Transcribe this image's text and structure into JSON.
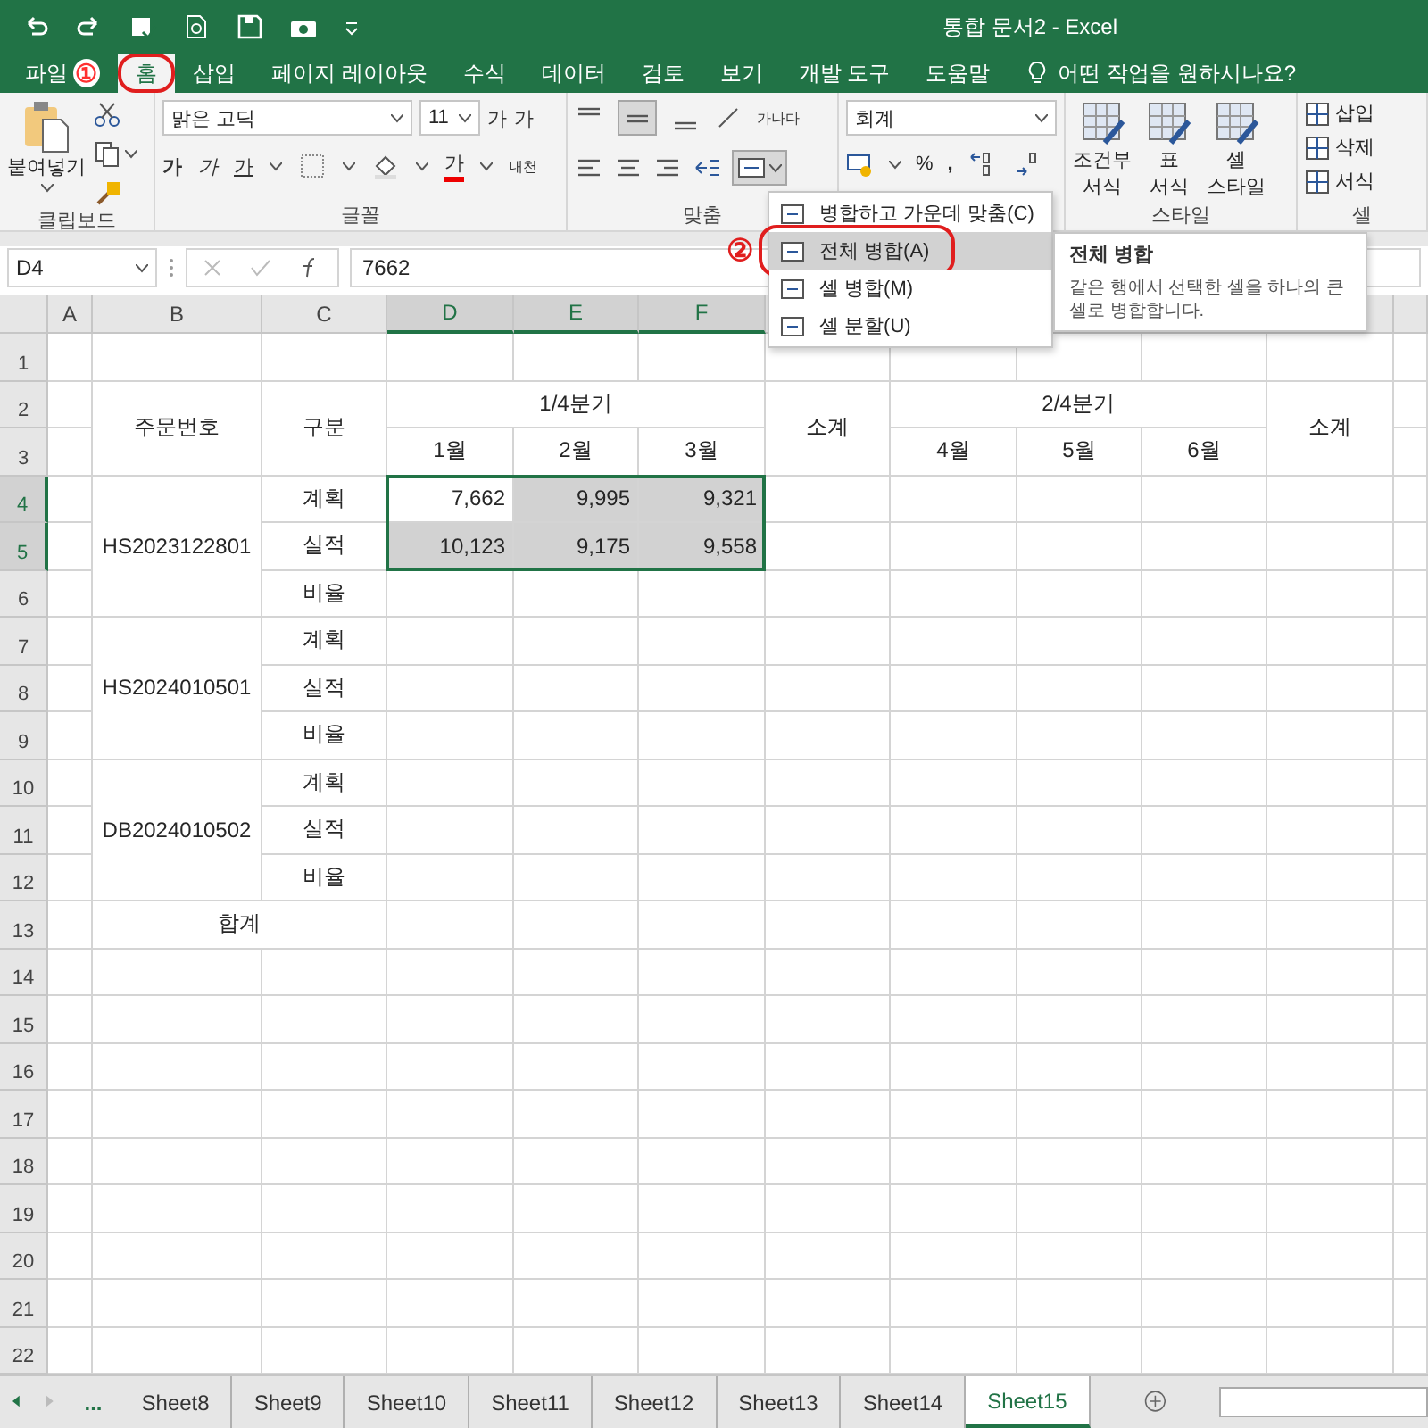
{
  "title_bar": {
    "title": "통합 문서2  -  Excel"
  },
  "ribbon_tabs": [
    {
      "label": "파일",
      "selected": false,
      "step": "①",
      "highlighted": false
    },
    {
      "label": "홈",
      "selected": true,
      "highlighted": true
    },
    {
      "label": "삽입",
      "selected": false,
      "highlighted": false
    },
    {
      "label": "페이지 레이아웃",
      "selected": false,
      "highlighted": false
    },
    {
      "label": "수식",
      "selected": false,
      "highlighted": false
    },
    {
      "label": "데이터",
      "selected": false,
      "highlighted": false
    },
    {
      "label": "검토",
      "selected": false,
      "highlighted": false
    },
    {
      "label": "보기",
      "selected": false,
      "highlighted": false
    },
    {
      "label": "개발 도구",
      "selected": false,
      "highlighted": false
    },
    {
      "label": "도움말",
      "selected": false,
      "highlighted": false
    }
  ],
  "tell_me": {
    "placeholder": "어떤 작업을 원하시나요?"
  },
  "ribbon": {
    "clipboard": {
      "paste": "붙여넣기",
      "label": "클립보드"
    },
    "font": {
      "font_name": "맑은 고딕",
      "font_size": "11",
      "grow": "가",
      "shrink": "가",
      "bold": "가",
      "italic": "가",
      "underline": "가",
      "font_color": "가",
      "phonetic": "내천",
      "label": "글꼴"
    },
    "alignment": {
      "wrap": "가나다",
      "label": "맞춤"
    },
    "number": {
      "format": "회계",
      "percent": "%",
      "comma": ","
    },
    "styles": {
      "buttons": [
        {
          "line1": "조건부",
          "line2": "서식"
        },
        {
          "line1": "표",
          "line2": "서식"
        },
        {
          "line1": "셀",
          "line2": "스타일"
        }
      ],
      "label": "스타일"
    },
    "cells": {
      "buttons": [
        "삽입",
        "삭제",
        "서식"
      ],
      "label": "셀"
    }
  },
  "formula_bar": {
    "name_box": "D4",
    "value": "7662"
  },
  "merge_menu": [
    {
      "label": "병합하고 가운데 맞춤(C)",
      "selected": false,
      "highlighted": false
    },
    {
      "label": "전체 병합(A)",
      "selected": true,
      "highlighted": true,
      "step": "②"
    },
    {
      "label": "셀 병합(M)",
      "selected": false,
      "highlighted": false
    },
    {
      "label": "셀 분할(U)",
      "selected": false,
      "highlighted": false
    }
  ],
  "tooltip": {
    "title": "전체 병합",
    "text": "같은 행에서 선택한 셀을 하나의 큰 셀로 병합합니다."
  },
  "sheet": {
    "columns": [
      {
        "label": "A",
        "selected": false
      },
      {
        "label": "B",
        "selected": false
      },
      {
        "label": "C",
        "selected": false
      },
      {
        "label": "D",
        "selected": true
      },
      {
        "label": "E",
        "selected": true
      },
      {
        "label": "F",
        "selected": true
      }
    ],
    "rows": [
      {
        "label": "1",
        "selected": false
      },
      {
        "label": "2",
        "selected": false
      },
      {
        "label": "3",
        "selected": false
      },
      {
        "label": "4",
        "selected": true
      },
      {
        "label": "5",
        "selected": true
      },
      {
        "label": "6",
        "selected": false
      },
      {
        "label": "7",
        "selected": false
      },
      {
        "label": "8",
        "selected": false
      },
      {
        "label": "9",
        "selected": false
      },
      {
        "label": "10",
        "selected": false
      },
      {
        "label": "11",
        "selected": false
      },
      {
        "label": "12",
        "selected": false
      },
      {
        "label": "13",
        "selected": false
      },
      {
        "label": "14",
        "selected": false
      },
      {
        "label": "15",
        "selected": false
      },
      {
        "label": "16",
        "selected": false
      },
      {
        "label": "17",
        "selected": false
      },
      {
        "label": "18",
        "selected": false
      },
      {
        "label": "19",
        "selected": false
      },
      {
        "label": "20",
        "selected": false
      },
      {
        "label": "21",
        "selected": false
      },
      {
        "label": "22",
        "selected": false
      }
    ],
    "cells": [
      {
        "text": "주문번호",
        "kind": "text"
      },
      {
        "text": "구분",
        "kind": "text"
      },
      {
        "text": "1/4분기",
        "kind": "text"
      },
      {
        "text": "소계",
        "kind": "text"
      },
      {
        "text": "2/4분기",
        "kind": "text"
      },
      {
        "text": "소계",
        "kind": "text"
      },
      {
        "text": "1월",
        "kind": "text"
      },
      {
        "text": "2월",
        "kind": "text"
      },
      {
        "text": "3월",
        "kind": "text"
      },
      {
        "text": "4월",
        "kind": "text"
      },
      {
        "text": "5월",
        "kind": "text"
      },
      {
        "text": "6월",
        "kind": "text"
      },
      {
        "text": "HS2023122801",
        "kind": "text"
      },
      {
        "text": "계획",
        "kind": "text"
      },
      {
        "text": "7,662",
        "kind": "number",
        "selected": true,
        "active": true
      },
      {
        "text": "9,995",
        "kind": "number",
        "selected": true,
        "active": false
      },
      {
        "text": "9,321",
        "kind": "number",
        "selected": true,
        "active": false
      },
      {
        "text": "실적",
        "kind": "text"
      },
      {
        "text": "10,123",
        "kind": "number",
        "selected": true,
        "active": false
      },
      {
        "text": "9,175",
        "kind": "number",
        "selected": true,
        "active": false
      },
      {
        "text": "9,558",
        "kind": "number",
        "selected": true,
        "active": false
      },
      {
        "text": "비율",
        "kind": "text"
      },
      {
        "text": "HS2024010501",
        "kind": "text"
      },
      {
        "text": "계획",
        "kind": "text"
      },
      {
        "text": "실적",
        "kind": "text"
      },
      {
        "text": "비율",
        "kind": "text"
      },
      {
        "text": "DB2024010502",
        "kind": "text"
      },
      {
        "text": "계획",
        "kind": "text"
      },
      {
        "text": "실적",
        "kind": "text"
      },
      {
        "text": "비율",
        "kind": "text"
      },
      {
        "text": "합계",
        "kind": "text"
      }
    ]
  },
  "sheet_tabs": {
    "more": "...",
    "tabs": [
      {
        "label": "Sheet8",
        "selected": false
      },
      {
        "label": "Sheet9",
        "selected": false
      },
      {
        "label": "Sheet10",
        "selected": false
      },
      {
        "label": "Sheet11",
        "selected": false
      },
      {
        "label": "Sheet12",
        "selected": false
      },
      {
        "label": "Sheet13",
        "selected": false
      },
      {
        "label": "Sheet14",
        "selected": false
      },
      {
        "label": "Sheet15",
        "selected": true
      }
    ]
  }
}
